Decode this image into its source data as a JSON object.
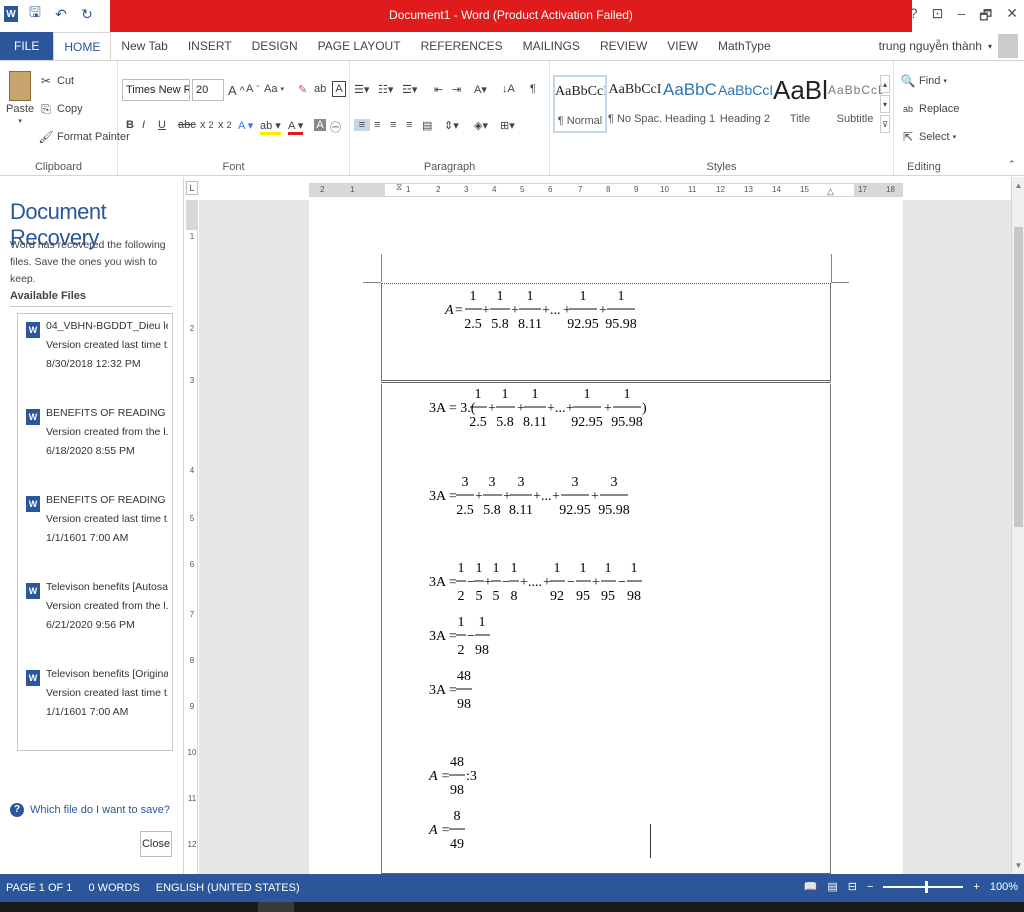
{
  "title": "Document1 - Word (Product Activation Failed)",
  "qat": {
    "save": "save-icon",
    "undo": "undo-icon",
    "redo": "redo-icon"
  },
  "window": {
    "help": "?",
    "restore_ribbon": "⊡",
    "minimize": "–",
    "maximize": "🗗",
    "close": "✕"
  },
  "tabs": [
    "FILE",
    "HOME",
    "New Tab",
    "INSERT",
    "DESIGN",
    "PAGE LAYOUT",
    "REFERENCES",
    "MAILINGS",
    "REVIEW",
    "VIEW",
    "MathType"
  ],
  "active_tab": "HOME",
  "user": "trung nguyễn thành",
  "clipboard": {
    "paste": "Paste",
    "cut": "Cut",
    "copy": "Copy",
    "format_painter": "Format Painter",
    "label": "Clipboard"
  },
  "font": {
    "name": "Times New Ro",
    "size": "20",
    "label": "Font",
    "aa": "Aa"
  },
  "paragraph": {
    "label": "Paragraph"
  },
  "styles": {
    "label": "Styles",
    "items": [
      {
        "preview": "AaBbCcI",
        "name": "¶ Normal"
      },
      {
        "preview": "AaBbCcI",
        "name": "¶ No Spac..."
      },
      {
        "preview": "AaBbC(",
        "name": "Heading 1"
      },
      {
        "preview": "AaBbCcD",
        "name": "Heading 2"
      },
      {
        "preview": "AaBl",
        "name": "Title"
      },
      {
        "preview": "AaBbCcD",
        "name": "Subtitle"
      }
    ]
  },
  "editing": {
    "find": "Find",
    "replace": "Replace",
    "select": "Select",
    "label": "Editing"
  },
  "recovery": {
    "title": "Document Recovery",
    "message": "Word has recovered the following files. Save the ones you wish to keep.",
    "available": "Available Files",
    "files": [
      {
        "name": "04_VBHN-BGDDT_Dieu le t...",
        "desc": "Version created last time t...",
        "date": "8/30/2018 12:32 PM"
      },
      {
        "name": "BENEFITS OF READING BO...",
        "desc": "Version created from the l...",
        "date": "6/18/2020 8:55 PM"
      },
      {
        "name": "BENEFITS OF READING BO...",
        "desc": "Version created last time t...",
        "date": "1/1/1601 7:00 AM"
      },
      {
        "name": "Televison benefits  [Autosa...",
        "desc": "Version created from the l...",
        "date": "6/21/2020 9:56 PM"
      },
      {
        "name": "Televison benefits  [Original]",
        "desc": "Version created last time t...",
        "date": "1/1/1601 7:00 AM"
      }
    ],
    "help": "Which file do I want to save?",
    "close": "Close"
  },
  "ruler": {
    "h": [
      "2",
      "1",
      "1",
      "2",
      "3",
      "4",
      "5",
      "6",
      "7",
      "8",
      "9",
      "10",
      "11",
      "12",
      "13",
      "14",
      "15",
      "17",
      "18"
    ],
    "v": [
      "1",
      "2",
      "3",
      "4",
      "5",
      "6",
      "7",
      "8",
      "9",
      "10",
      "11",
      "12"
    ],
    "corner": "L"
  },
  "math": {
    "eq1": {
      "lhs": "A",
      "den": [
        "2.5",
        "5.8",
        "8.11",
        "92.95",
        "95.98"
      ],
      "num": "1",
      "dots": "..."
    },
    "eq2": {
      "lhs": "3A = 3.(",
      "den": [
        "2.5",
        "5.8",
        "8.11",
        "92.95",
        "95.98"
      ],
      "num": "1",
      "close": ")"
    },
    "eq3": {
      "lhs": "3A = ",
      "den": [
        "2.5",
        "5.8",
        "8.11",
        "92.95",
        "95.98"
      ],
      "num": "3"
    },
    "eq4": {
      "lhs": "3A = ",
      "den": [
        "2",
        "5",
        "5",
        "8",
        "92",
        "95",
        "95",
        "98"
      ],
      "num": "1"
    },
    "eq5": {
      "lhs": "3A = ",
      "den": [
        "2",
        "98"
      ],
      "num": "1"
    },
    "eq6": {
      "lhs": "3A = ",
      "num": "48",
      "den": "98"
    },
    "eq7": {
      "lhs": "A = ",
      "num": "48",
      "den": "98",
      "tail": ":3"
    },
    "eq8": {
      "lhs": "A = ",
      "num": "8",
      "den": "49"
    }
  },
  "status": {
    "page": "PAGE 1 OF 1",
    "words": "0 WORDS",
    "lang": "ENGLISH (UNITED STATES)",
    "zoom": "100%"
  }
}
